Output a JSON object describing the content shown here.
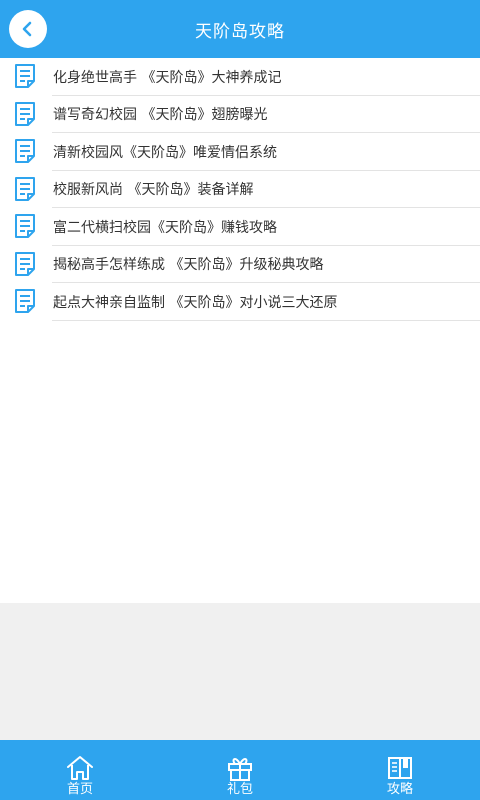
{
  "header": {
    "title": "天阶岛攻略",
    "back_icon": "chevron-left-icon"
  },
  "articles": [
    {
      "title": "化身绝世高手 《天阶岛》大神养成记"
    },
    {
      "title": "谱写奇幻校园 《天阶岛》翅膀曝光"
    },
    {
      "title": "清新校园风《天阶岛》唯爱情侣系统"
    },
    {
      "title": "校服新风尚 《天阶岛》装备详解"
    },
    {
      "title": "富二代横扫校园《天阶岛》赚钱攻略"
    },
    {
      "title": "揭秘高手怎样练成 《天阶岛》升级秘典攻略"
    },
    {
      "title": "起点大神亲自监制 《天阶岛》对小说三大还原"
    }
  ],
  "tabbar": {
    "tabs": [
      {
        "label": "首页",
        "icon": "home-icon"
      },
      {
        "label": "礼包",
        "icon": "gift-icon"
      },
      {
        "label": "攻略",
        "icon": "book-icon"
      }
    ]
  },
  "colors": {
    "accent": "#2ea4ee",
    "list_icon": "#2ea4ee",
    "text": "#333333"
  }
}
